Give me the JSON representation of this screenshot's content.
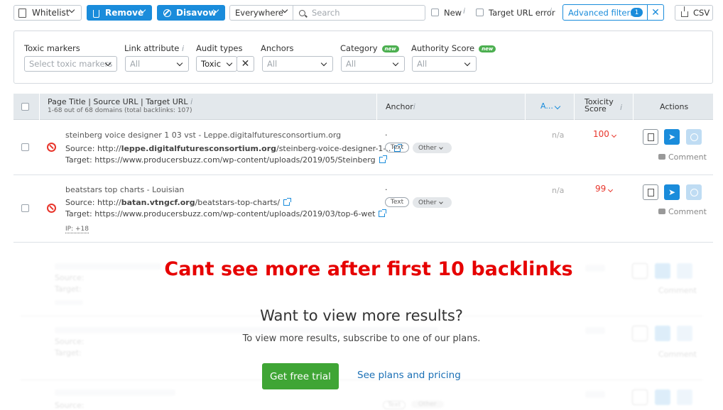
{
  "toolbar": {
    "whitelist_label": "Whitelist",
    "remove_label": "Remove",
    "disavow_label": "Disavow",
    "scope_value": "Everywhere",
    "search_placeholder": "Search",
    "new_label": "New",
    "target_url_error_label": "Target URL error",
    "advanced_filters_label": "Advanced filters",
    "advanced_filters_count": "1",
    "csv_label": "CSV"
  },
  "filters": {
    "toxic_markers": {
      "label": "Toxic markers",
      "placeholder": "Select toxic markers"
    },
    "link_attribute": {
      "label": "Link attribute",
      "value": "All"
    },
    "audit_types": {
      "label": "Audit types",
      "value": "Toxic"
    },
    "anchors": {
      "label": "Anchors",
      "value": "All"
    },
    "category": {
      "label": "Category",
      "badge": "new",
      "value": "All"
    },
    "authority_score": {
      "label": "Authority Score",
      "badge": "new",
      "value": "All"
    }
  },
  "table": {
    "col_page": "Page Title | Source URL | Target URL",
    "col_page_sub": "1-68 out of 68 domains (total backlinks: 107)",
    "col_anchor": "Anchor",
    "col_as": "A...",
    "col_toxicity": "Toxicity Score",
    "col_actions": "Actions",
    "rows": [
      {
        "title": "steinberg voice designer 1 03 vst - Leppe.digitalfuturesconsortium.org",
        "source_label": "Source:",
        "source_prefix": "http://",
        "source_domain": "leppe.digitalfuturesconsortium.org",
        "source_path": "/steinberg-voice-designer-1-..",
        "target_label": "Target:",
        "target_url": "https://www.producersbuzz.com/wp-content/uploads/2019/05/Steinberg",
        "anchor": ".",
        "anchor_type": "Text",
        "anchor_category": "Other",
        "as_value": "n/a",
        "toxicity": "100",
        "comment_label": "Comment"
      },
      {
        "title": "beatstars top charts - Louisian",
        "source_label": "Source:",
        "source_prefix": "http://",
        "source_domain": "batan.vtngcf.org",
        "source_path": "/beatstars-top-charts/",
        "target_label": "Target:",
        "target_url": "https://www.producersbuzz.com/wp-content/uploads/2019/03/top-6-wet",
        "ip_label": "IP: +18",
        "anchor": ".",
        "anchor_type": "Text",
        "anchor_category": "Other",
        "as_value": "n/a",
        "toxicity": "99",
        "comment_label": "Comment"
      }
    ],
    "blurred_source_label": "Source:",
    "blurred_target_label": "Target:",
    "blurred_comment_label": "Comment",
    "blurred_text_label": "Text",
    "blurred_other_label": "Other"
  },
  "overlay": {
    "annotation": "Cant see more after first 10 backlinks",
    "heading": "Want to view more results?",
    "subtext": "To view more results, subscribe to one of our plans.",
    "cta_label": "Get free trial",
    "plans_link": "See plans and pricing"
  },
  "colors": {
    "accent": "#1a8cdb",
    "danger": "#e8352b",
    "cta": "#3fa535",
    "annotation": "#e60000"
  }
}
